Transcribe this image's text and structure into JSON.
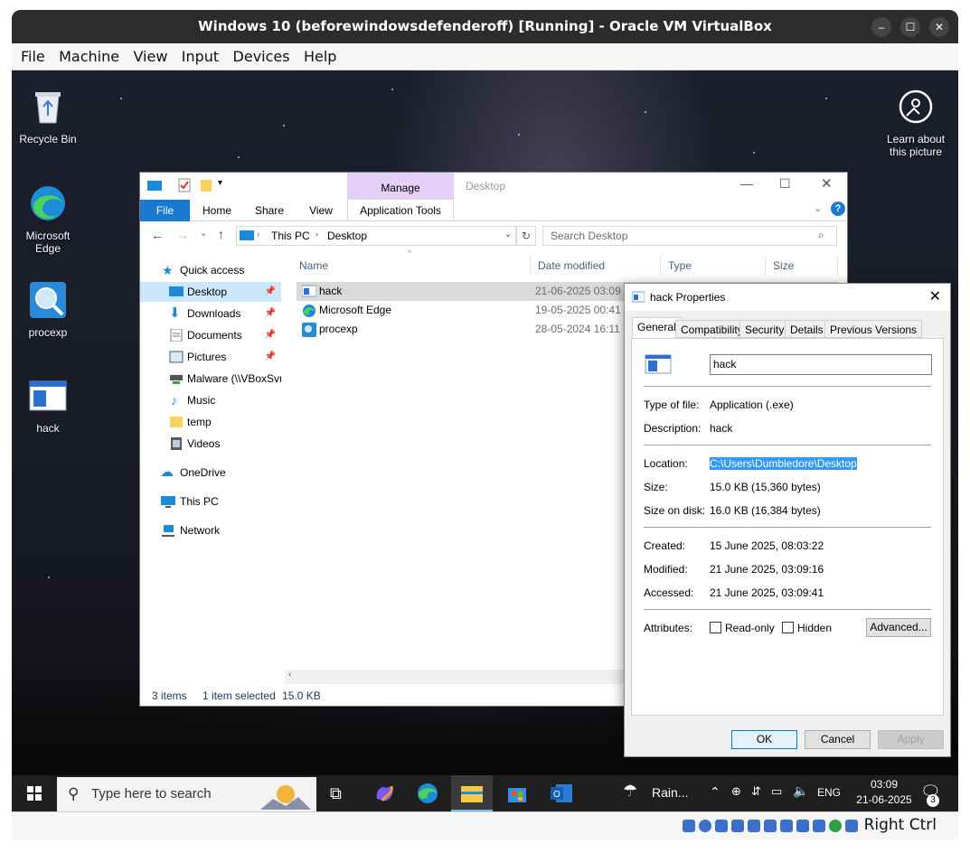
{
  "vbox": {
    "title": "Windows 10 (beforewindowsdefenderoff) [Running] - Oracle VM VirtualBox",
    "menu": [
      "File",
      "Machine",
      "View",
      "Input",
      "Devices",
      "Help"
    ],
    "host_key": "Right Ctrl",
    "window_controls": {
      "minimize": "–",
      "maximize": "☐",
      "close": "✕"
    }
  },
  "desktop": {
    "icons": [
      {
        "label": "Recycle Bin"
      },
      {
        "label": "Microsoft Edge"
      },
      {
        "label": "procexp"
      },
      {
        "label": "hack"
      }
    ],
    "spotlight": {
      "label": "Learn about this picture"
    }
  },
  "explorer": {
    "ribbon": {
      "contextual_group": "Manage",
      "location_label": "Desktop",
      "tabs": [
        "File",
        "Home",
        "Share",
        "View",
        "Application Tools"
      ]
    },
    "address": {
      "segments": [
        "This PC",
        "Desktop"
      ]
    },
    "search": {
      "placeholder": "Search Desktop"
    },
    "nav": [
      {
        "label": "Quick access"
      },
      {
        "label": "Desktop"
      },
      {
        "label": "Downloads"
      },
      {
        "label": "Documents"
      },
      {
        "label": "Pictures"
      },
      {
        "label": "Malware (\\\\VBoxSvr"
      },
      {
        "label": "Music"
      },
      {
        "label": "temp"
      },
      {
        "label": "Videos"
      },
      {
        "label": "OneDrive"
      },
      {
        "label": "This PC"
      },
      {
        "label": "Network"
      }
    ],
    "columns": [
      "Name",
      "Date modified",
      "Type",
      "Size"
    ],
    "files": [
      {
        "name": "hack",
        "date": "21-06-2025 03:09"
      },
      {
        "name": "Microsoft Edge",
        "date": "19-05-2025 00:41"
      },
      {
        "name": "procexp",
        "date": "28-05-2024 16:11"
      }
    ],
    "status": {
      "items": "3 items",
      "selected": "1 item selected",
      "size": "15.0 KB"
    }
  },
  "properties": {
    "title": "hack Properties",
    "tabs": [
      "General",
      "Compatibility",
      "Security",
      "Details",
      "Previous Versions"
    ],
    "name_value": "hack",
    "rows": {
      "type_label": "Type of file:",
      "type_value": "Application (.exe)",
      "desc_label": "Description:",
      "desc_value": "hack",
      "location_label": "Location:",
      "location_value": "C:\\Users\\Dumbledore\\Desktop",
      "size_label": "Size:",
      "size_value": "15.0 KB (15,360 bytes)",
      "sizedisk_label": "Size on disk:",
      "sizedisk_value": "16.0 KB (16,384 bytes)",
      "created_label": "Created:",
      "created_value": "15 June 2025, 08:03:22",
      "modified_label": "Modified:",
      "modified_value": "21 June 2025, 03:09:16",
      "accessed_label": "Accessed:",
      "accessed_value": "21 June 2025, 03:09:41",
      "attributes_label": "Attributes:"
    },
    "attributes": {
      "readonly": "Read-only",
      "hidden": "Hidden",
      "advanced": "Advanced..."
    },
    "buttons": {
      "ok": "OK",
      "cancel": "Cancel",
      "apply": "Apply"
    }
  },
  "taskbar": {
    "search_placeholder": "Type here to search",
    "weather": "Rain...",
    "language": "ENG",
    "time": "03:09",
    "date": "21-06-2025",
    "notifications": "3"
  },
  "colors": {
    "accent": "#0078d7",
    "selection": "#3399ff",
    "manage_tab": "#e5d1f7"
  }
}
